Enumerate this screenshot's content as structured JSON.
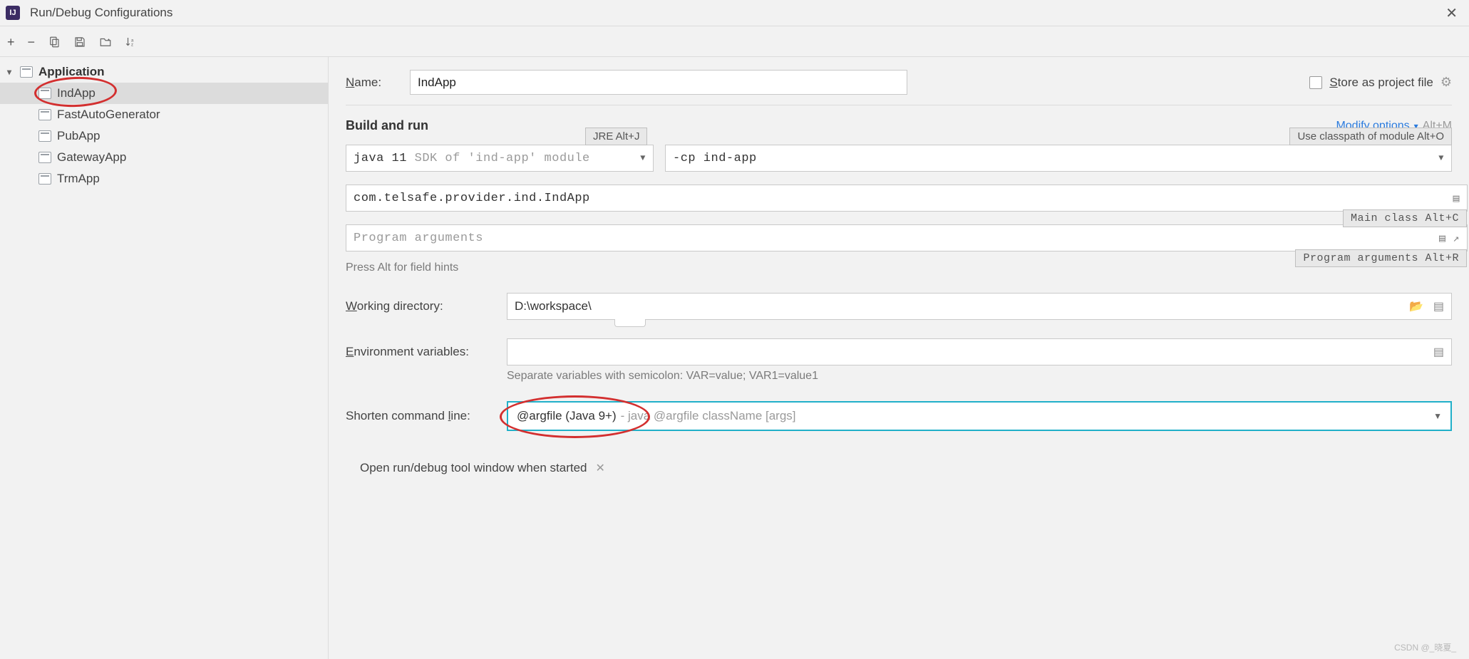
{
  "window": {
    "title": "Run/Debug Configurations",
    "app_abbrev": "IJ"
  },
  "toolbar": {
    "add": "+",
    "remove": "−",
    "copy": "⿻",
    "save": "💾",
    "folder": "📁",
    "sort": "↓ᴬᴢ"
  },
  "tree": {
    "root_label": "Application",
    "items": [
      {
        "label": "IndApp",
        "selected": true
      },
      {
        "label": "FastAutoGenerator",
        "selected": false
      },
      {
        "label": "PubApp",
        "selected": false
      },
      {
        "label": "GatewayApp",
        "selected": false
      },
      {
        "label": "TrmApp",
        "selected": false
      }
    ]
  },
  "form": {
    "name_label": "Name:",
    "name_label_u": "N",
    "name_value": "IndApp",
    "store_label": "Store as project file",
    "store_label_u": "S",
    "build_title": "Build and run",
    "modify_label": "Modify options",
    "modify_shortcut": "Alt+M",
    "hint_jre": "JRE Alt+J",
    "hint_cp": "Use classpath of module Alt+O",
    "hint_main": "Main class Alt+C",
    "hint_args": "Program arguments Alt+R",
    "sdk_prefix": "java 11 ",
    "sdk_suffix": "SDK of 'ind-app' module",
    "cp_value": "-cp ind-app",
    "main_class": "com.telsafe.provider.ind.IndApp",
    "args_placeholder": "Program arguments",
    "press_hint": "Press Alt for field hints",
    "workdir_label": "Working directory:",
    "workdir_label_u": "W",
    "workdir_value": "D:\\workspace\\",
    "env_label": "Environment variables:",
    "env_label_u": "E",
    "env_value": "",
    "env_hint": "Separate variables with semicolon: VAR=value; VAR1=value1",
    "shorten_label": "Shorten command line:",
    "shorten_label_u": "l",
    "shorten_value": "@argfile (Java 9+)",
    "shorten_dim": " - java @argfile className [args]",
    "open_label": "Open run/debug tool window when started"
  },
  "watermark": "CSDN @_晓夏_"
}
